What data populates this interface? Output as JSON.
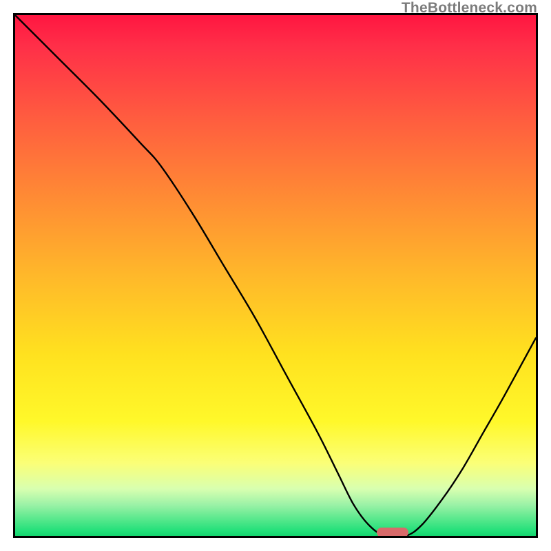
{
  "watermark": "TheBottleneck.com",
  "chart_data": {
    "type": "line",
    "title": "",
    "xlabel": "",
    "ylabel": "",
    "xlim": [
      0,
      100
    ],
    "ylim": [
      0,
      100
    ],
    "grid": false,
    "series": [
      {
        "name": "bottleneck-curve",
        "x": [
          0,
          8,
          16,
          24,
          28,
          34,
          40,
          46,
          52,
          58,
          62,
          65,
          68,
          71,
          75,
          78,
          82,
          86,
          90,
          94,
          100
        ],
        "values": [
          100,
          92,
          84,
          75.5,
          71,
          62,
          52,
          42,
          31,
          20,
          12,
          6,
          2,
          0,
          0,
          2,
          7,
          13,
          20,
          27,
          38
        ]
      }
    ],
    "marker": {
      "x_center": 72.5,
      "y_center": 0.6,
      "color": "#d86a6a"
    },
    "background_gradient_stops": [
      {
        "pos": 0.0,
        "color": "#ff1641"
      },
      {
        "pos": 0.06,
        "color": "#ff2f48"
      },
      {
        "pos": 0.2,
        "color": "#ff5d3f"
      },
      {
        "pos": 0.35,
        "color": "#ff8b34"
      },
      {
        "pos": 0.5,
        "color": "#ffb82a"
      },
      {
        "pos": 0.65,
        "color": "#ffe11f"
      },
      {
        "pos": 0.78,
        "color": "#fff82a"
      },
      {
        "pos": 0.86,
        "color": "#fbff77"
      },
      {
        "pos": 0.91,
        "color": "#d8ffb0"
      },
      {
        "pos": 0.94,
        "color": "#9cf2a7"
      },
      {
        "pos": 0.965,
        "color": "#5fe98f"
      },
      {
        "pos": 0.99,
        "color": "#23e07a"
      },
      {
        "pos": 1.0,
        "color": "#14d66f"
      }
    ]
  }
}
